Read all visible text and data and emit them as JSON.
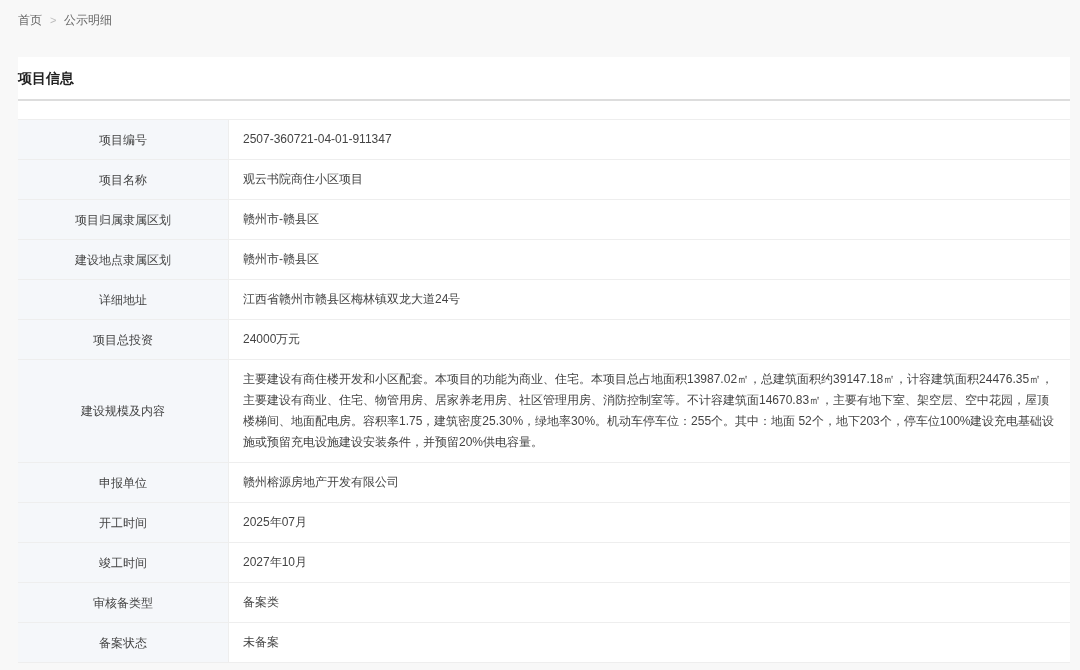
{
  "breadcrumb": {
    "items": [
      "首页",
      "公示明细"
    ],
    "separator": ">"
  },
  "section": {
    "title": "项目信息"
  },
  "table": {
    "rows": [
      {
        "label": "项目编号",
        "value": "2507-360721-04-01-911347"
      },
      {
        "label": "项目名称",
        "value": "观云书院商住小区项目"
      },
      {
        "label": "项目归属隶属区划",
        "value": "赣州市-赣县区"
      },
      {
        "label": "建设地点隶属区划",
        "value": "赣州市-赣县区"
      },
      {
        "label": "详细地址",
        "value": "江西省赣州市赣县区梅林镇双龙大道24号"
      },
      {
        "label": "项目总投资",
        "value": "24000万元"
      },
      {
        "label": "建设规模及内容",
        "value": "主要建设有商住楼开发和小区配套。本项目的功能为商业、住宅。本项目总占地面积13987.02㎡，总建筑面积约39147.18㎡，计容建筑面积24476.35㎡，主要建设有商业、住宅、物管用房、居家养老用房、社区管理用房、消防控制室等。不计容建筑面14670.83㎡，主要有地下室、架空层、空中花园，屋顶楼梯间、地面配电房。容积率1.75，建筑密度25.30%，绿地率30%。机动车停车位：255个。其中：地面 52个，地下203个，停车位100%建设充电基础设施或预留充电设施建设安装条件，并预留20%供电容量。"
      },
      {
        "label": "申报单位",
        "value": "赣州榕源房地产开发有限公司"
      },
      {
        "label": "开工时间",
        "value": "2025年07月"
      },
      {
        "label": "竣工时间",
        "value": "2027年10月"
      },
      {
        "label": "审核备类型",
        "value": "备案类"
      },
      {
        "label": "备案状态",
        "value": "未备案"
      }
    ]
  }
}
